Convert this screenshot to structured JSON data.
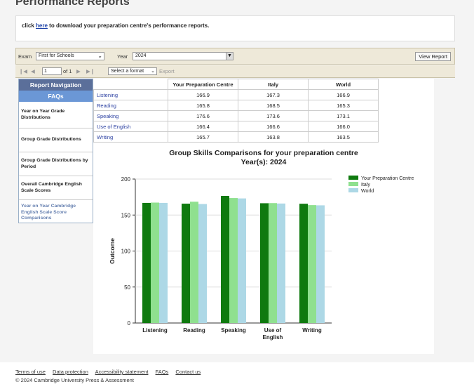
{
  "page": {
    "title": "Performance Reports"
  },
  "download": {
    "prefix": "click",
    "link": "here",
    "suffix": "to download your preparation centre's performance reports."
  },
  "filters": {
    "exam_label": "Exam",
    "exam_value": "First for Schools",
    "year_label": "Year",
    "year_value": "2024",
    "view_button": "View Report"
  },
  "toolbar": {
    "page_value": "1",
    "of_label": "of 1",
    "format_placeholder": "Select a format",
    "export_label": "Export"
  },
  "nav": {
    "header": "Report Navigation",
    "faq": "FAQs",
    "items": [
      "Year on Year Grade Distributions",
      "Group Grade Distributions",
      "Group Grade Distributions by Period",
      "Overall Cambridge English Scale Scores",
      "Year on Year Cambridge English Scale Score Comparisons"
    ]
  },
  "table": {
    "headers": [
      "",
      "Your Preparation Centre",
      "Italy",
      "World"
    ],
    "rows": [
      {
        "skill": "Listening",
        "centre": "166.9",
        "italy": "167.3",
        "world": "166.9"
      },
      {
        "skill": "Reading",
        "centre": "165.8",
        "italy": "168.5",
        "world": "165.3"
      },
      {
        "skill": "Speaking",
        "centre": "176.6",
        "italy": "173.6",
        "world": "173.1"
      },
      {
        "skill": "Use of English",
        "centre": "166.4",
        "italy": "166.6",
        "world": "166.0"
      },
      {
        "skill": "Writing",
        "centre": "165.7",
        "italy": "163.8",
        "world": "163.5"
      }
    ]
  },
  "chart_data": {
    "type": "bar",
    "title": "Group Skills Comparisons for your preparation centre",
    "subtitle": "Year(s): 2024",
    "ylabel": "Outcome",
    "xlabel": "",
    "categories": [
      "Listening",
      "Reading",
      "Speaking",
      "Use of English",
      "Writing"
    ],
    "ylim": [
      0,
      200
    ],
    "yticks": [
      0,
      50,
      100,
      150,
      200
    ],
    "grid": true,
    "legend": "top-right",
    "series": [
      {
        "name": "Your Preparation Centre",
        "color": "#0f7a0f",
        "values": [
          166.9,
          165.8,
          176.6,
          166.4,
          165.7
        ]
      },
      {
        "name": "Italy",
        "color": "#8fe08f",
        "values": [
          167.3,
          168.5,
          173.6,
          166.6,
          163.8
        ]
      },
      {
        "name": "World",
        "color": "#add8e6",
        "values": [
          166.9,
          165.3,
          173.1,
          166.0,
          163.5
        ]
      }
    ]
  },
  "footer": {
    "links": [
      "Terms of use",
      "Data protection",
      "Accessibility statement",
      "FAQs",
      "Contact us"
    ],
    "copyright": "© 2024 Cambridge University Press & Assessment"
  }
}
